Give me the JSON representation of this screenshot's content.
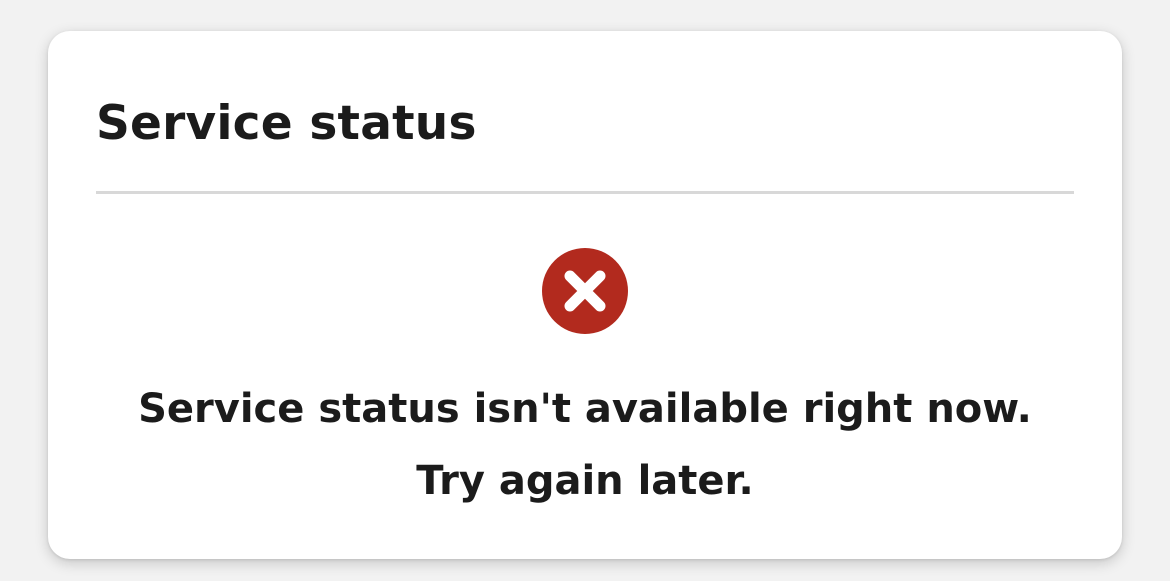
{
  "card": {
    "title": "Service status"
  },
  "status": {
    "icon": "error-x-circle-icon",
    "icon_color": "#b22a1e",
    "message_line_1": "Service status isn't available right now.",
    "message_line_2": "Try again later."
  }
}
